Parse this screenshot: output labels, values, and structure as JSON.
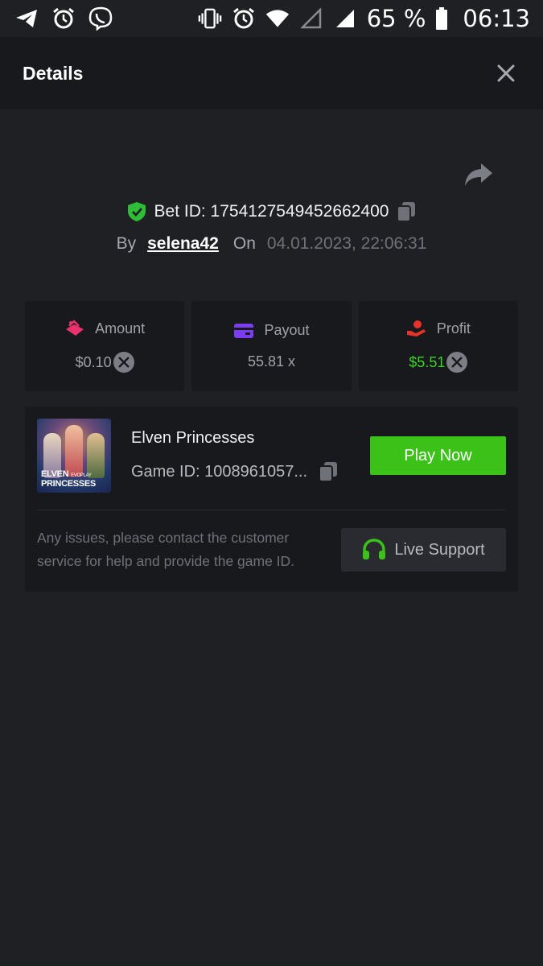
{
  "status_bar": {
    "battery": "65 %",
    "time": "06:13",
    "left_icons": [
      "telegram-icon",
      "alarm-icon",
      "viber-icon"
    ],
    "right_icons": [
      "vibrate-icon",
      "alarm-icon",
      "wifi-icon",
      "signal-empty-icon",
      "signal-icon",
      "battery-icon"
    ]
  },
  "header": {
    "title": "Details"
  },
  "bet": {
    "id_text": "Bet ID: 1754127549452662400",
    "by_label": "By",
    "username": "selena42",
    "on_label": "On",
    "date": "04.01.2023, 22:06:31"
  },
  "stats": {
    "amount": {
      "label": "Amount",
      "value": "$0.10",
      "icon": "amount-icon",
      "color": "#e8336e"
    },
    "payout": {
      "label": "Payout",
      "value": "55.81 x",
      "icon": "card-icon",
      "color": "#7b3df0"
    },
    "profit": {
      "label": "Profit",
      "value": "$5.51",
      "icon": "hand-coin-icon",
      "color": "#e8332b"
    }
  },
  "game": {
    "thumb_line1": "ELVEN",
    "thumb_brand": "EVOPLAY",
    "thumb_line2": "PRINCESSES",
    "title": "Elven Princesses",
    "game_id": "Game ID: 1008961057...",
    "play_label": "Play Now",
    "help_text": "Any issues, please contact the customer service for help and provide the game ID.",
    "support_label": "Live Support"
  },
  "colors": {
    "background": "#1f2024",
    "panel": "#18191c",
    "accent_green": "#3bc117",
    "profit_green": "#3dd12a"
  }
}
